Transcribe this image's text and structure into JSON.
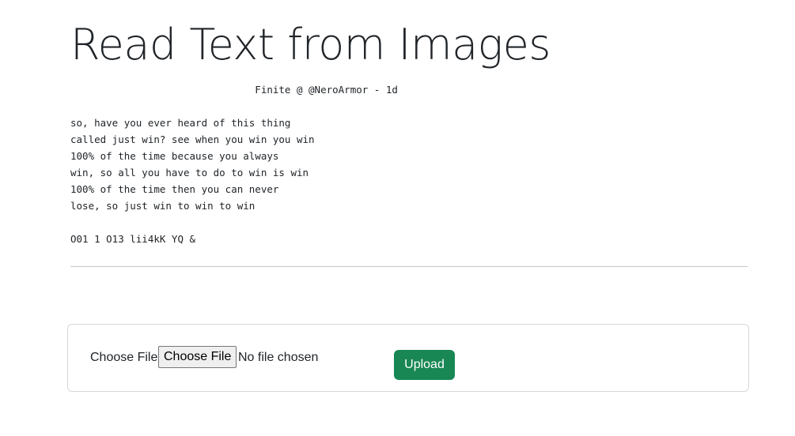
{
  "page": {
    "title": "Read Text from Images"
  },
  "ocr_result": {
    "text": "                               Finite @ @NeroArmor - 1d\n\nso, have you ever heard of this thing\ncalled just win? see when you win you win\n100% of the time because you always\nwin, so all you have to do to win is win\n100% of the time then you can never\nlose, so just win to win to win\n\nO01 1 O13 lii4kK YQ &"
  },
  "upload_form": {
    "file_label": "Choose File",
    "file_button_label": "Choose File",
    "file_status": "No file chosen",
    "upload_label": "Upload"
  },
  "colors": {
    "upload_button": "#198754",
    "divider": "#c8c8c8",
    "card_border": "#d6d8db"
  }
}
